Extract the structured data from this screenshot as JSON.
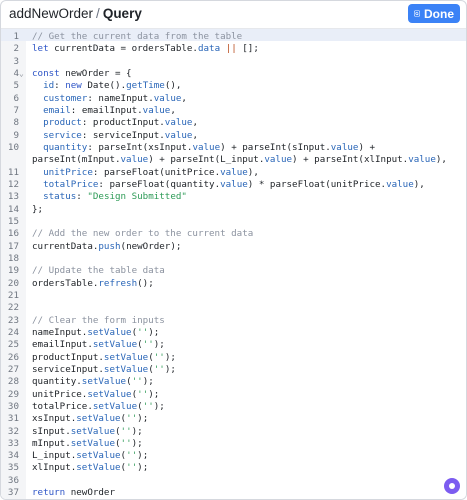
{
  "header": {
    "app_name": "addNewOrder",
    "separator": "/",
    "section": "Query",
    "done_label": "Done"
  },
  "editor": {
    "active_line": 1,
    "fold_marker_line": 4,
    "lines": [
      {
        "n": "1",
        "tokens": [
          [
            "com",
            "// Get the current data from the table"
          ]
        ]
      },
      {
        "n": "2",
        "tokens": [
          [
            "kw",
            "let "
          ],
          [
            "var",
            "currentData = ordersTable."
          ],
          [
            "prop",
            "data"
          ],
          [
            "var",
            " "
          ],
          [
            "op",
            "||"
          ],
          [
            "var",
            " [];"
          ]
        ]
      },
      {
        "n": "3",
        "tokens": []
      },
      {
        "n": "4",
        "tokens": [
          [
            "kw",
            "const "
          ],
          [
            "var",
            "newOrder = {"
          ]
        ]
      },
      {
        "n": "5",
        "tokens": [
          [
            "var",
            "  "
          ],
          [
            "prop",
            "id"
          ],
          [
            "var",
            ": "
          ],
          [
            "kw",
            "new "
          ],
          [
            "var",
            "Date()."
          ],
          [
            "fn",
            "getTime"
          ],
          [
            "var",
            "(),"
          ]
        ]
      },
      {
        "n": "6",
        "tokens": [
          [
            "var",
            "  "
          ],
          [
            "prop",
            "customer"
          ],
          [
            "var",
            ": nameInput."
          ],
          [
            "prop",
            "value"
          ],
          [
            "var",
            ","
          ]
        ]
      },
      {
        "n": "7",
        "tokens": [
          [
            "var",
            "  "
          ],
          [
            "prop",
            "email"
          ],
          [
            "var",
            ": emailInput."
          ],
          [
            "prop",
            "value"
          ],
          [
            "var",
            ","
          ]
        ]
      },
      {
        "n": "8",
        "tokens": [
          [
            "var",
            "  "
          ],
          [
            "prop",
            "product"
          ],
          [
            "var",
            ": productInput."
          ],
          [
            "prop",
            "value"
          ],
          [
            "var",
            ","
          ]
        ]
      },
      {
        "n": "9",
        "tokens": [
          [
            "var",
            "  "
          ],
          [
            "prop",
            "service"
          ],
          [
            "var",
            ": serviceInput."
          ],
          [
            "prop",
            "value"
          ],
          [
            "var",
            ","
          ]
        ]
      },
      {
        "n": "10",
        "tokens": [
          [
            "var",
            "  "
          ],
          [
            "prop",
            "quantity"
          ],
          [
            "var",
            ": parseInt(xsInput."
          ],
          [
            "prop",
            "value"
          ],
          [
            "var",
            ") + parseInt(sInput."
          ],
          [
            "prop",
            "value"
          ],
          [
            "var",
            ") +"
          ]
        ]
      },
      {
        "n": "",
        "tokens": [
          [
            "var",
            "parseInt(mInput."
          ],
          [
            "prop",
            "value"
          ],
          [
            "var",
            ") + parseInt(L_input."
          ],
          [
            "prop",
            "value"
          ],
          [
            "var",
            ") + parseInt(xlInput."
          ],
          [
            "prop",
            "value"
          ],
          [
            "var",
            "),"
          ]
        ]
      },
      {
        "n": "11",
        "tokens": [
          [
            "var",
            "  "
          ],
          [
            "prop",
            "unitPrice"
          ],
          [
            "var",
            ": parseFloat(unitPrice."
          ],
          [
            "prop",
            "value"
          ],
          [
            "var",
            "),"
          ]
        ]
      },
      {
        "n": "12",
        "tokens": [
          [
            "var",
            "  "
          ],
          [
            "prop",
            "totalPrice"
          ],
          [
            "var",
            ": parseFloat(quantity."
          ],
          [
            "prop",
            "value"
          ],
          [
            "var",
            ") * parseFloat(unitPrice."
          ],
          [
            "prop",
            "value"
          ],
          [
            "var",
            "),"
          ]
        ]
      },
      {
        "n": "13",
        "tokens": [
          [
            "var",
            "  "
          ],
          [
            "prop",
            "status"
          ],
          [
            "var",
            ": "
          ],
          [
            "str",
            "\"Design Submitted\""
          ]
        ]
      },
      {
        "n": "14",
        "tokens": [
          [
            "var",
            "};"
          ]
        ]
      },
      {
        "n": "15",
        "tokens": []
      },
      {
        "n": "16",
        "tokens": [
          [
            "com",
            "// Add the new order to the current data"
          ]
        ]
      },
      {
        "n": "17",
        "tokens": [
          [
            "var",
            "currentData."
          ],
          [
            "fn",
            "push"
          ],
          [
            "var",
            "(newOrder);"
          ]
        ]
      },
      {
        "n": "18",
        "tokens": []
      },
      {
        "n": "19",
        "tokens": [
          [
            "com",
            "// Update the table data"
          ]
        ]
      },
      {
        "n": "20",
        "tokens": [
          [
            "var",
            "ordersTable."
          ],
          [
            "fn",
            "refresh"
          ],
          [
            "var",
            "();"
          ]
        ]
      },
      {
        "n": "21",
        "tokens": []
      },
      {
        "n": "22",
        "tokens": []
      },
      {
        "n": "23",
        "tokens": [
          [
            "com",
            "// Clear the form inputs"
          ]
        ]
      },
      {
        "n": "24",
        "tokens": [
          [
            "var",
            "nameInput."
          ],
          [
            "fn",
            "setValue"
          ],
          [
            "var",
            "("
          ],
          [
            "str",
            "''"
          ],
          [
            "var",
            ");"
          ]
        ]
      },
      {
        "n": "25",
        "tokens": [
          [
            "var",
            "emailInput."
          ],
          [
            "fn",
            "setValue"
          ],
          [
            "var",
            "("
          ],
          [
            "str",
            "''"
          ],
          [
            "var",
            ");"
          ]
        ]
      },
      {
        "n": "26",
        "tokens": [
          [
            "var",
            "productInput."
          ],
          [
            "fn",
            "setValue"
          ],
          [
            "var",
            "("
          ],
          [
            "str",
            "''"
          ],
          [
            "var",
            ");"
          ]
        ]
      },
      {
        "n": "27",
        "tokens": [
          [
            "var",
            "serviceInput."
          ],
          [
            "fn",
            "setValue"
          ],
          [
            "var",
            "("
          ],
          [
            "str",
            "''"
          ],
          [
            "var",
            ");"
          ]
        ]
      },
      {
        "n": "28",
        "tokens": [
          [
            "var",
            "quantity."
          ],
          [
            "fn",
            "setValue"
          ],
          [
            "var",
            "("
          ],
          [
            "str",
            "''"
          ],
          [
            "var",
            ");"
          ]
        ]
      },
      {
        "n": "29",
        "tokens": [
          [
            "var",
            "unitPrice."
          ],
          [
            "fn",
            "setValue"
          ],
          [
            "var",
            "("
          ],
          [
            "str",
            "''"
          ],
          [
            "var",
            ");"
          ]
        ]
      },
      {
        "n": "30",
        "tokens": [
          [
            "var",
            "totalPrice."
          ],
          [
            "fn",
            "setValue"
          ],
          [
            "var",
            "("
          ],
          [
            "str",
            "''"
          ],
          [
            "var",
            ");"
          ]
        ]
      },
      {
        "n": "31",
        "tokens": [
          [
            "var",
            "xsInput."
          ],
          [
            "fn",
            "setValue"
          ],
          [
            "var",
            "("
          ],
          [
            "str",
            "''"
          ],
          [
            "var",
            ");"
          ]
        ]
      },
      {
        "n": "32",
        "tokens": [
          [
            "var",
            "sInput."
          ],
          [
            "fn",
            "setValue"
          ],
          [
            "var",
            "("
          ],
          [
            "str",
            "''"
          ],
          [
            "var",
            ");"
          ]
        ]
      },
      {
        "n": "33",
        "tokens": [
          [
            "var",
            "mInput."
          ],
          [
            "fn",
            "setValue"
          ],
          [
            "var",
            "("
          ],
          [
            "str",
            "''"
          ],
          [
            "var",
            ");"
          ]
        ]
      },
      {
        "n": "34",
        "tokens": [
          [
            "var",
            "L_input."
          ],
          [
            "fn",
            "setValue"
          ],
          [
            "var",
            "("
          ],
          [
            "str",
            "''"
          ],
          [
            "var",
            ");"
          ]
        ]
      },
      {
        "n": "35",
        "tokens": [
          [
            "var",
            "xlInput."
          ],
          [
            "fn",
            "setValue"
          ],
          [
            "var",
            "("
          ],
          [
            "str",
            "''"
          ],
          [
            "var",
            ");"
          ]
        ]
      },
      {
        "n": "36",
        "tokens": []
      },
      {
        "n": "37",
        "tokens": [
          [
            "kw",
            "return "
          ],
          [
            "var",
            "newOrder"
          ]
        ]
      },
      {
        "n": "38",
        "tokens": []
      }
    ]
  },
  "icons": {
    "done_icon": "g-logo-icon",
    "help_icon": "assistant-icon"
  },
  "colors": {
    "accent": "#3b82f6",
    "keyword": "#2f56c7",
    "string": "#2e9b57",
    "comment": "#8c93a0",
    "assistant": "#7c5cf0"
  }
}
